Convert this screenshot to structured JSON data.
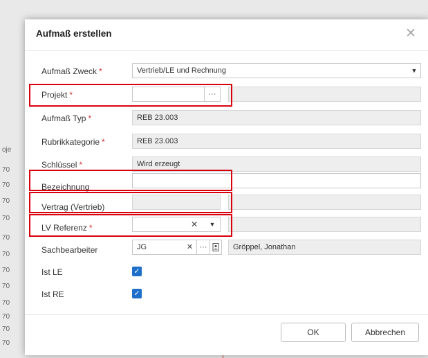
{
  "dialog": {
    "title": "Aufmaß erstellen",
    "close_icon": "close-icon",
    "ok_label": "OK",
    "cancel_label": "Abbrechen"
  },
  "background": {
    "left_fragments": [
      "oje",
      "70",
      "70",
      "70",
      "70",
      "70",
      "70",
      "70",
      "70",
      "70",
      "70",
      "70",
      "70"
    ]
  },
  "fields": {
    "zweck": {
      "label": "Aufmaß Zweck",
      "required": "*",
      "value": "Vertrieb/LE und Rechnung",
      "icon": "chevron-down-icon"
    },
    "projekt": {
      "label": "Projekt",
      "required": "*",
      "value": "",
      "more": "···"
    },
    "typ": {
      "label": "Aufmaß Typ",
      "required": "*",
      "value": "REB 23.003"
    },
    "rubrik": {
      "label": "Rubrikkategorie",
      "required": "*",
      "value": "REB 23.003"
    },
    "schluessel": {
      "label": "Schlüssel",
      "required": "*",
      "value": "Wird erzeugt"
    },
    "bezeichnung": {
      "label": "Bezeichnung",
      "value": ""
    },
    "vertrag": {
      "label": "Vertrag (Vertrieb)",
      "value": ""
    },
    "lv": {
      "label": "LV Referenz",
      "required": "*",
      "value": "",
      "clear": "✕"
    },
    "sachbearbeiter": {
      "label": "Sachbearbeiter",
      "value": "JG",
      "clear": "✕",
      "more": "···",
      "name": "Gröppel, Jonathan"
    },
    "ist_le": {
      "label": "Ist LE",
      "checked": true
    },
    "ist_re": {
      "label": "Ist RE",
      "checked": true
    }
  },
  "colors": {
    "highlight": "#d9000d",
    "required": "#d32f2f",
    "checkbox": "#1e6fc9"
  }
}
